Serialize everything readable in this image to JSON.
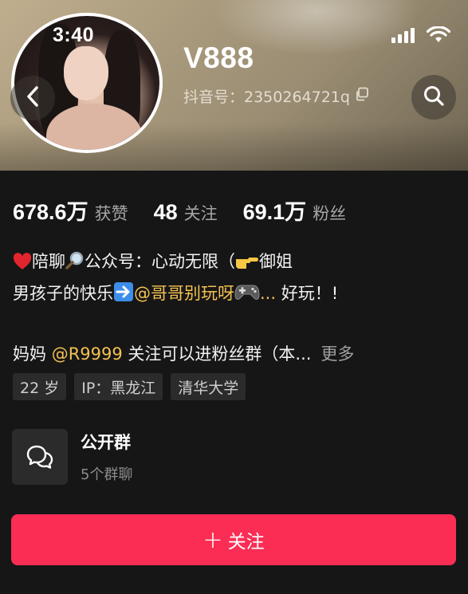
{
  "status_bar": {
    "time": "3:40"
  },
  "profile": {
    "name": "V888",
    "douyin_id": "抖音号：2350264721q"
  },
  "stats": [
    {
      "value": "678.6万",
      "label": "获赞"
    },
    {
      "value": "48",
      "label": "关注"
    },
    {
      "value": "69.1万",
      "label": "粉丝"
    }
  ],
  "bio": {
    "line1": {
      "text_a": "陪聊",
      "text_b": "公众号：心动无限（",
      "text_c": "御姐"
    },
    "line2": {
      "text_a": "男孩子的快乐",
      "mention": "@哥哥别玩呀",
      "ellipsis": "...",
      "text_b": " 好玩！!"
    },
    "line3": {
      "text_a": "妈妈 ",
      "mention": "@R9999",
      "text_b": " 关注可以进粉丝群（本...",
      "more": "更多"
    }
  },
  "tags": [
    "22 岁",
    "IP：黑龙江",
    "清华大学"
  ],
  "group": {
    "title": "公开群",
    "subtitle": "5个群聊"
  },
  "follow_button": {
    "plus": "+",
    "label": "关注"
  },
  "colors": {
    "accent": "#fb2d55",
    "mention": "#f4c152",
    "background": "#161616"
  },
  "icons": [
    "back-chevron-icon",
    "search-icon",
    "signal-icon",
    "wifi-icon",
    "copy-icon",
    "heart-icon",
    "magnifier-icon",
    "pointing-hand-icon",
    "right-arrow-icon",
    "gamepad-icon",
    "group-chat-icon"
  ]
}
